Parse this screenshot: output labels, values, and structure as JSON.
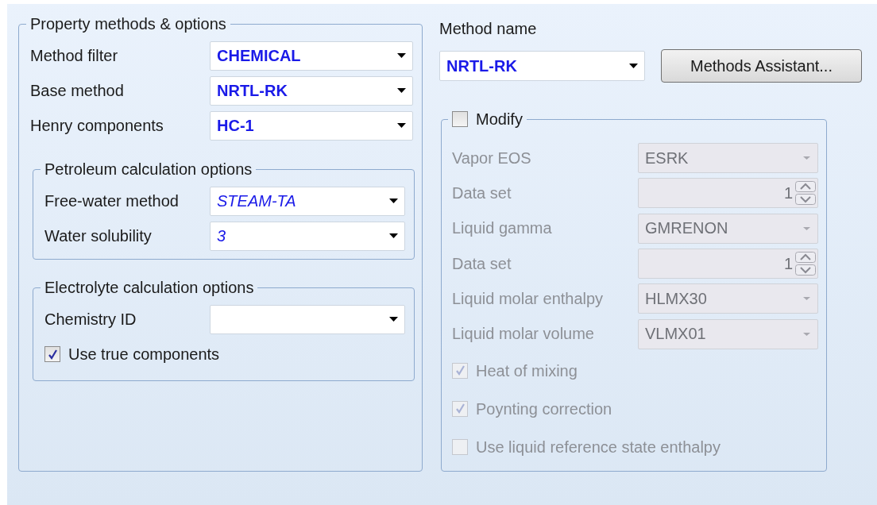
{
  "property_methods": {
    "title": "Property methods & options",
    "fields": [
      {
        "label": "Method filter",
        "value": "CHEMICAL",
        "default": false
      },
      {
        "label": "Base method",
        "value": "NRTL-RK",
        "default": false
      },
      {
        "label": "Henry components",
        "value": "HC-1",
        "default": false
      }
    ],
    "petroleum": {
      "title": "Petroleum calculation options",
      "fields": [
        {
          "label": "Free-water method",
          "value": "STEAM-TA",
          "default": true
        },
        {
          "label": "Water solubility",
          "value": "3",
          "default": true
        }
      ]
    },
    "electrolyte": {
      "title": "Electrolyte calculation options",
      "fields": [
        {
          "label": "Chemistry ID"
        }
      ],
      "checkbox": {
        "label": "Use true components",
        "checked": true
      }
    }
  },
  "method_name": {
    "label": "Method name",
    "value": "NRTL-RK",
    "default": false,
    "button": "Methods Assistant..."
  },
  "modify": {
    "label": "Modify",
    "checked": false,
    "fields": [
      {
        "kind": "combo",
        "label": "Vapor EOS",
        "value": "ESRK",
        "disabled": true
      },
      {
        "kind": "spin",
        "label": "Data set",
        "value": "1",
        "disabled": true
      },
      {
        "kind": "combo",
        "label": "Liquid gamma",
        "value": "GMRENON",
        "disabled": true
      },
      {
        "kind": "spin",
        "label": "Data set",
        "value": "1",
        "disabled": true
      },
      {
        "kind": "combo",
        "label": "Liquid molar enthalpy",
        "value": "HLMX30",
        "disabled": true
      },
      {
        "kind": "combo",
        "label": "Liquid molar volume",
        "value": "VLMX01",
        "disabled": true
      }
    ],
    "checkboxes": [
      {
        "label": "Heat of mixing",
        "checked": true,
        "disabled": true
      },
      {
        "label": "Poynting correction",
        "checked": true,
        "disabled": true
      },
      {
        "label": "Use liquid reference state enthalpy",
        "checked": false,
        "disabled": true
      }
    ]
  }
}
